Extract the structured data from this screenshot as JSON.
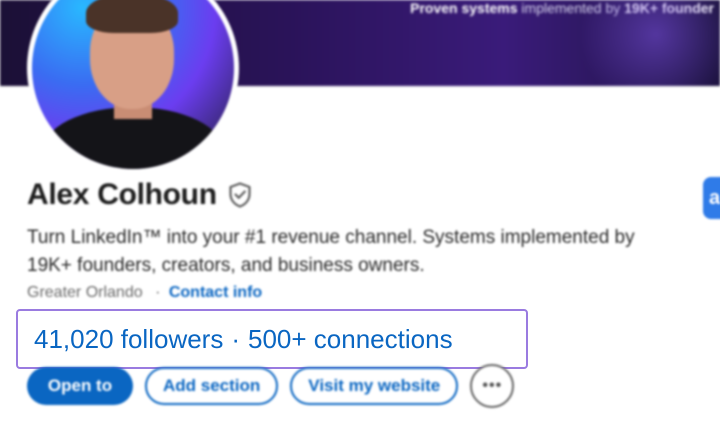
{
  "banner": {
    "tagline_bold_1": "Proven systems",
    "tagline_mid": " implemented by ",
    "tagline_bold_2": "19K+ founder"
  },
  "profile": {
    "name": "Alex Colhoun",
    "verified_icon": "shield-check-icon",
    "headline": "Turn LinkedIn™ into your #1 revenue channel. Systems implemented by 19K+ founders, creators, and business owners.",
    "location": "Greater Orlando",
    "location_separator": "·",
    "contact_label": "Contact info"
  },
  "network": {
    "followers": "41,020 followers",
    "separator": "·",
    "connections": "500+ connections",
    "highlight_color": "#9a7be0"
  },
  "actions": {
    "open_to_label": "Open to",
    "add_section_label": "Add section",
    "visit_website_label": "Visit my website",
    "more_label": "•••"
  },
  "edge_button": {
    "label": "a"
  },
  "colors": {
    "link_blue": "#0a66c2",
    "text_dark": "#1d1d1d"
  }
}
